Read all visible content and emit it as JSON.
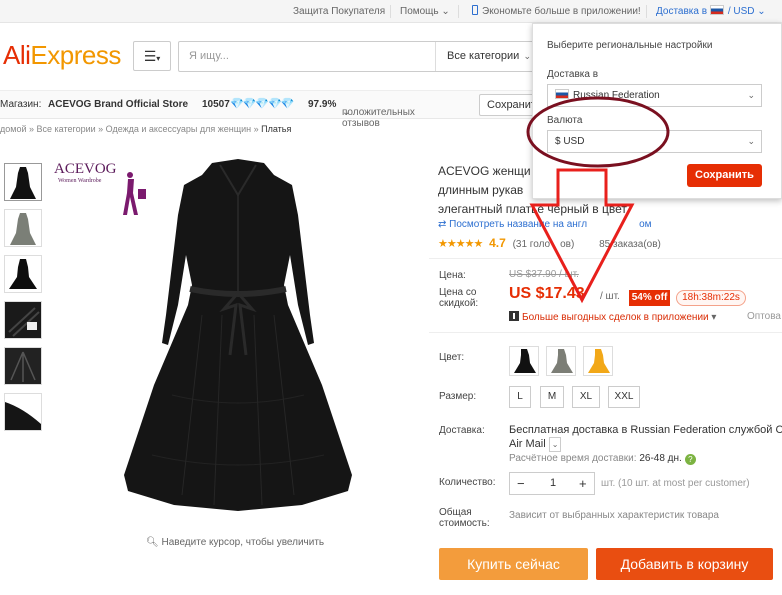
{
  "topbar": {
    "buyer_protection": "Защита Покупателя",
    "help": "Помощь",
    "app_promo": "Экономьте больше в приложении!",
    "ship_to_currency": "Доставка в",
    "currency": "USD"
  },
  "header": {
    "logo_ali": "Ali",
    "logo_express": "Express",
    "search_placeholder": "Я ищу...",
    "category": "Все категории"
  },
  "store": {
    "label": "Магазин:",
    "name": "ACEVOG Brand Official Store",
    "score": "10507",
    "feedback_pct": "97.9%",
    "feedback_text": "положительных отзывов",
    "save_button": "Сохранить"
  },
  "breadcrumb": {
    "items": [
      "домой",
      "Все категории",
      "Одежда и аксессуары для женщин"
    ],
    "current": "Платья"
  },
  "product": {
    "title_line1": "ACEVOG женщи",
    "title_line2": "длинным рукав",
    "title_line3": "элегантный платье черный в цвет",
    "translate": "Посмотреть название на англ",
    "translate_tail": "ом",
    "rating": "4.7",
    "reviews": "(31 голо",
    "reviews_tail": "ов)",
    "orders": "85 заказа(ов)",
    "brand_logo": "ACEVOG",
    "brand_tagline": "Women Wardrobe",
    "zoom_hint": "Наведите курсор, чтобы увеличить"
  },
  "pricing": {
    "price_label": "Цена:",
    "old_price": "US $37.90 / шт.",
    "discount_label_1": "Цена со",
    "discount_label_2": "скидкой:",
    "price": "US $17.43",
    "unit": "/ шт.",
    "off": "54% off",
    "timer": "18h:38m:22s",
    "app_deal": "Больше выгодных сделок в приложении",
    "app_deal_more": "Оптова"
  },
  "options": {
    "color_label": "Цвет:",
    "colors": [
      "black",
      "gray",
      "yellow"
    ],
    "size_label": "Размер:",
    "sizes": [
      "L",
      "M",
      "XL",
      "XXL"
    ],
    "shipping_label": "Доставка:",
    "shipping_line1": "Бесплатная доставка в Russian Federation службой Ch",
    "shipping_line2": "Air Mail",
    "delivery_time_label": "Расчётное время доставки:",
    "delivery_time": "26-48 дн.",
    "quantity_label": "Количество:",
    "quantity": "1",
    "quantity_note": "шт. (10 шт. at most per customer)",
    "total_label_1": "Общая",
    "total_label_2": "стоимость:",
    "total_note": "Зависит от выбранных характеристик товара"
  },
  "actions": {
    "buy_now": "Купить сейчас",
    "add_to_cart": "Добавить в корзину"
  },
  "region_popup": {
    "title": "Выберите региональные настройки",
    "shipping_label": "Доставка в",
    "country": "Russian Federation",
    "currency_label": "Валюта",
    "currency": "$ USD",
    "save": "Сохранить"
  },
  "colors": {
    "brand_red": "#e62e04",
    "annotation_red": "#e8201c",
    "annotation_ellipse": "#7a1020",
    "buy_orange": "#f39c3c",
    "cart_orange": "#e94e11"
  }
}
